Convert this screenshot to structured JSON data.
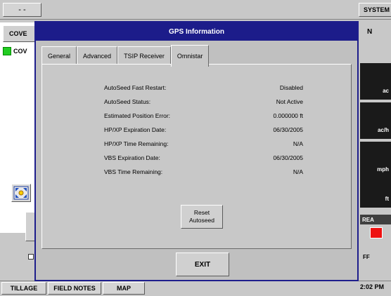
{
  "topbar": {
    "left_button": "- -",
    "system_label": "SYSTEM"
  },
  "background": {
    "tab_label": "COVE",
    "row_label": "COV",
    "n_label": "N",
    "right_units": [
      "ac",
      "ac/h",
      "mph",
      "ft"
    ],
    "area_label": "REA",
    "off_label": "FF",
    "clock": "2:02 PM"
  },
  "bottom_tabs": [
    "TILLAGE",
    "FIELD NOTES",
    "MAP"
  ],
  "dialog": {
    "title": "GPS Information",
    "tabs": [
      "General",
      "Advanced",
      "TSIP Receiver",
      "Omnistar"
    ],
    "active_tab": "Omnistar",
    "rows": [
      {
        "label": "AutoSeed Fast Restart:",
        "value": "Disabled"
      },
      {
        "label": "AutoSeed Status:",
        "value": "Not Active"
      },
      {
        "label": "Estimated Position Error:",
        "value": "0.000000 ft"
      },
      {
        "label": "HP/XP Expiration Date:",
        "value": "06/30/2005"
      },
      {
        "label": "HP/XP Time Remaining:",
        "value": "N/A"
      },
      {
        "label": "VBS Expiration Date:",
        "value": "06/30/2005"
      },
      {
        "label": "VBS Time Remaining:",
        "value": "N/A"
      }
    ],
    "reset_button": [
      "Reset",
      "Autoseed"
    ],
    "exit_button": "EXIT"
  },
  "colors": {
    "title_bar": "#1c1c8a",
    "indicator_red": "#ee1111",
    "indicator_green": "#22cc22"
  },
  "icons": {
    "map_button": "extent-arrows-icon"
  }
}
